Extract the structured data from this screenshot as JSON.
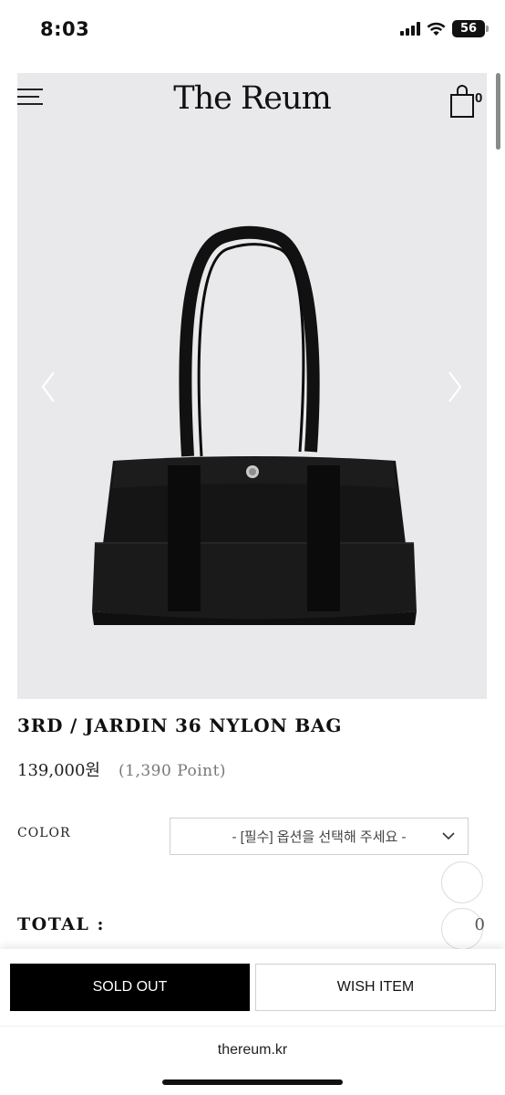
{
  "status_bar": {
    "time": "8:03",
    "battery": "56"
  },
  "header": {
    "brand": "The Reum",
    "cart_count": "0"
  },
  "product": {
    "title": "3RD / JARDIN 36 NYLON BAG",
    "price": "139,000원",
    "points": "(1,390 Point)"
  },
  "options": {
    "color_label": "COLOR",
    "select_placeholder": "- [필수] 옵션을 선택해 주세요 -"
  },
  "total": {
    "label": "TOTAL :",
    "value": "0"
  },
  "actions": {
    "sold_out": "SOLD OUT",
    "wish_item": "WISH ITEM"
  },
  "browser": {
    "url": "thereum.kr"
  },
  "icons": [
    "menu-icon",
    "shopping-bag-icon",
    "chevron-left-icon",
    "chevron-right-icon",
    "chevron-down-icon",
    "wifi-icon",
    "signal-icon",
    "battery-icon"
  ],
  "colors": {
    "accent": "#000000",
    "image_bg": "#e9e9eb"
  }
}
